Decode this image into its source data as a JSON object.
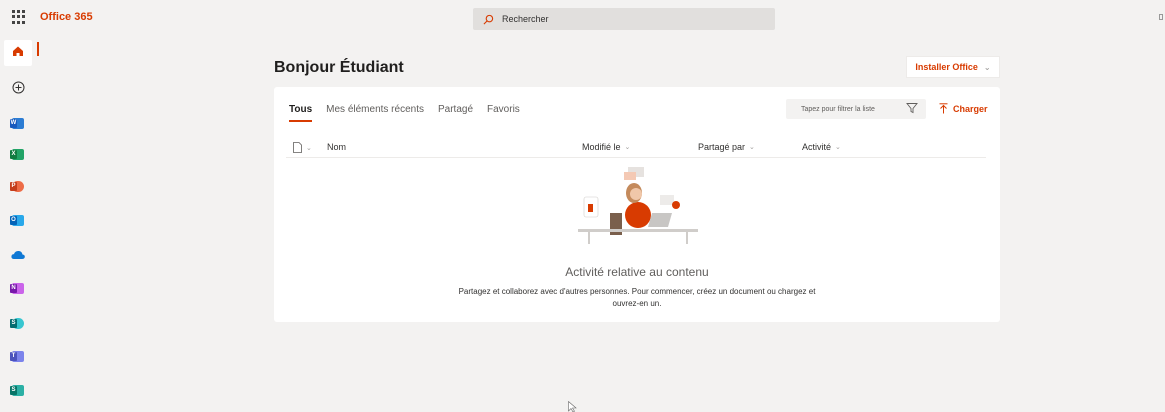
{
  "app": {
    "brand": "Office 365"
  },
  "search": {
    "placeholder": "Rechercher"
  },
  "main": {
    "greeting": "Bonjour Étudiant",
    "install_label": "Installer Office",
    "tabs": [
      {
        "label": "Tous",
        "active": true
      },
      {
        "label": "Mes éléments récents",
        "active": false
      },
      {
        "label": "Partagé",
        "active": false
      },
      {
        "label": "Favoris",
        "active": false
      }
    ],
    "filter_placeholder": "Tapez pour filtrer la liste",
    "upload_label": "Charger",
    "columns": {
      "name": "Nom",
      "modified": "Modifié le",
      "shared_by": "Partagé par",
      "activity": "Activité"
    },
    "empty_title": "Activité relative au contenu",
    "empty_description": "Partagez et collaborez avec d'autres personnes. Pour commencer, créez un document ou chargez et ouvrez-en un."
  },
  "rail": {
    "items": [
      "home-icon",
      "create-icon",
      "word-icon",
      "excel-icon",
      "powerpoint-icon",
      "outlook-icon",
      "onedrive-icon",
      "onenote-icon",
      "sharepoint-icon",
      "teams-icon",
      "sway-icon"
    ]
  },
  "colors": {
    "accent": "#d83b01",
    "background": "#f3f2f1",
    "card": "#ffffff"
  }
}
